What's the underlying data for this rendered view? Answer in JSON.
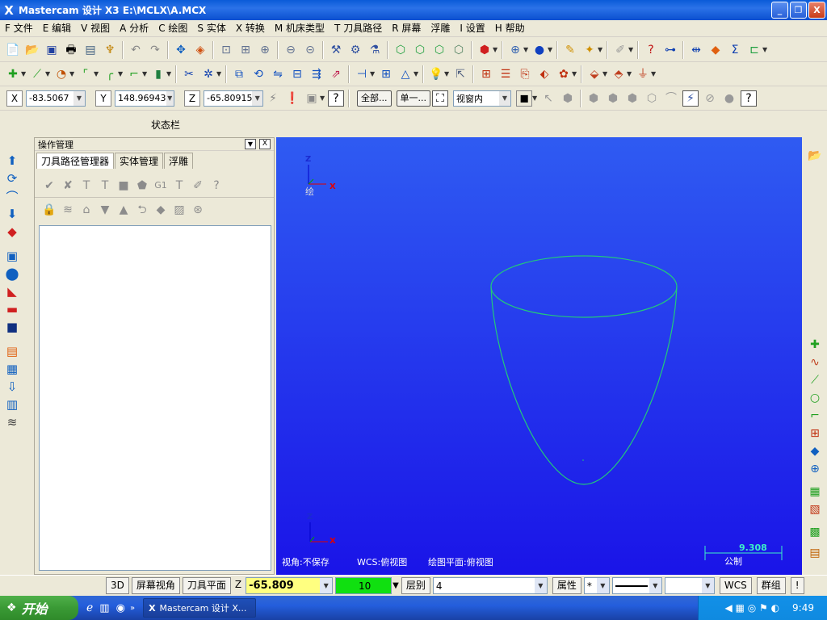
{
  "window": {
    "title": "Mastercam 设计 X3   E:\\MCLX\\A.MCX",
    "minimize": "_",
    "restore": "❐",
    "close": "X"
  },
  "menu": [
    "F 文件",
    "E 编辑",
    "V 视图",
    "A 分析",
    "C 绘图",
    "S 实体",
    "X 转换",
    "M 机床类型",
    "T 刀具路径",
    "R 屏幕",
    "浮雕",
    "I 设置",
    "H 帮助"
  ],
  "coords": {
    "x_label": "X",
    "x_value": "-83.5067",
    "y_label": "Y",
    "y_value": "148.96943",
    "z_label": "Z",
    "z_value": "-65.80915"
  },
  "toolbar3": {
    "all_button": "全部...",
    "single_button": "单一...",
    "view_select": "视窗内"
  },
  "status_label": "状态栏",
  "panel": {
    "title": "操作管理",
    "tabs": [
      "刀具路径管理器",
      "实体管理",
      "浮雕"
    ],
    "close": "X"
  },
  "viewport": {
    "axis_z": "Z",
    "axis_x": "X",
    "axis_y": "Y",
    "axis_label": "绘",
    "view_info": "视角:不保存",
    "wcs_info": "WCS:俯视图",
    "plane_info": "绘图平面:俯视图",
    "scale_value": "9.308",
    "scale_unit": "公制"
  },
  "bottombar": {
    "btn_3d": "3D",
    "btn_screen_view": "屏幕视角",
    "btn_tool_plane": "刀具平面",
    "z_label": "Z",
    "z_value": "-65.809",
    "color_value": "10",
    "layer_label": "层别",
    "layer_value": "4",
    "attr_label": "属性",
    "point_style": "*",
    "wcs": "WCS",
    "group": "群组",
    "help": "!"
  },
  "taskbar": {
    "start": "开始",
    "app_item": "Mastercam 设计 X...",
    "time": "9:49"
  },
  "colors": {
    "viewport_top": "#2f5bf2",
    "viewport_bottom": "#1a14e8",
    "wireframe": "#22c97a",
    "scale_text": "#3cf0c8"
  }
}
